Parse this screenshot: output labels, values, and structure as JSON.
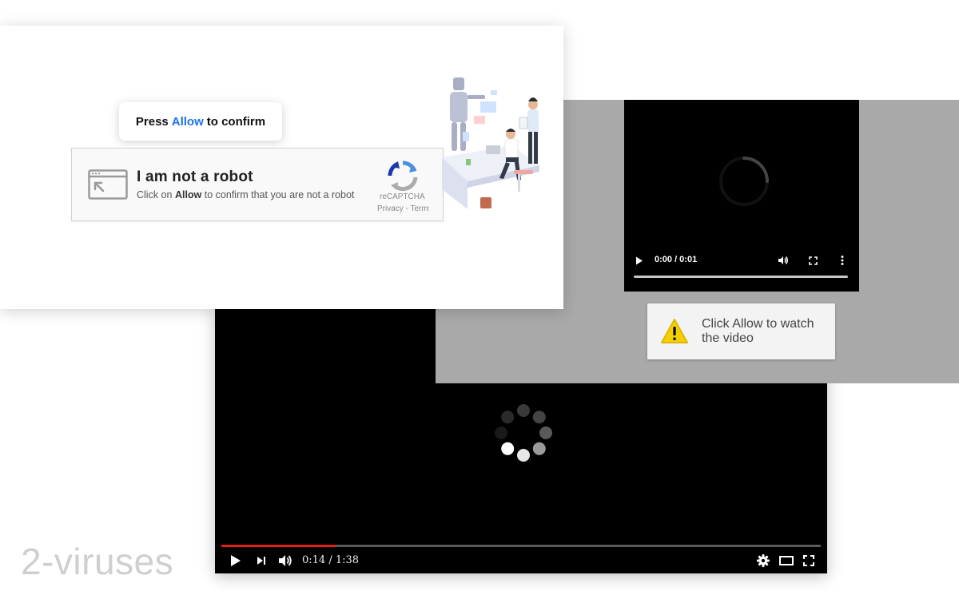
{
  "captcha": {
    "tooltip_press": "Press",
    "tooltip_allow": "Allow",
    "tooltip_confirm": "to confirm",
    "title": "I am not a robot",
    "subtitle_prefix": "Click on",
    "subtitle_allow": "Allow",
    "subtitle_suffix": "to confirm that you are not a robot",
    "recaptcha_label": "reCAPTCHA",
    "recaptcha_links": "Privacy - Terms",
    "accent_color": "#1a73e8"
  },
  "small_video": {
    "time": "0:00 / 0:01",
    "icons": [
      "play-icon",
      "volume-icon",
      "fullscreen-icon",
      "more-vert-icon"
    ]
  },
  "notification": {
    "text": "Click Allow to watch the video",
    "icon": "warning-icon",
    "icon_color": "#f5d000"
  },
  "main_video": {
    "time": "0:14 / 1:38",
    "progress": 0.19,
    "progress_color": "#e62117",
    "icons": [
      "play-icon",
      "next-icon",
      "volume-icon",
      "settings-icon",
      "theater-icon",
      "fullscreen-icon"
    ]
  },
  "watermark": "2-viruses"
}
